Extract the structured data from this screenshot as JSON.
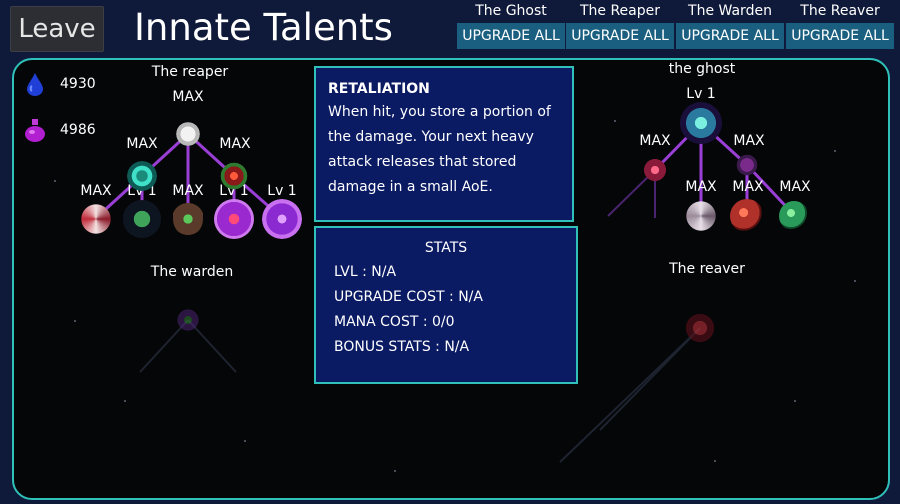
{
  "header": {
    "leave_label": "Leave",
    "title": "Innate Talents"
  },
  "upgrade_groups": [
    {
      "name": "The Ghost",
      "button": "UPGRADE ALL"
    },
    {
      "name": "The Reaper",
      "button": "UPGRADE ALL"
    },
    {
      "name": "The Warden",
      "button": "UPGRADE ALL"
    },
    {
      "name": "The Reaver",
      "button": "UPGRADE ALL"
    }
  ],
  "currencies": {
    "blue_mana": "4930",
    "purple_potion": "4986"
  },
  "trees": {
    "reaper": {
      "title": "The reaper",
      "labels": [
        "MAX",
        "MAX",
        "MAX",
        "MAX",
        "Lv 1",
        "MAX",
        "Lv 1",
        "Lv 1"
      ]
    },
    "ghost": {
      "title": "the ghost",
      "labels": [
        "Lv 1",
        "MAX",
        "MAX",
        "MAX",
        "MAX",
        "MAX"
      ]
    },
    "warden": {
      "title": "The warden"
    },
    "reaver": {
      "title": "The reaver"
    }
  },
  "info": {
    "name": "RETALIATION",
    "description": "When hit, you store a portion of the damage. Your next heavy attack releases that stored damage in a small AoE."
  },
  "stats": {
    "header": "STATS",
    "lines": [
      "LVL : N/A",
      "UPGRADE COST : N/A",
      "MANA COST : 0/0",
      "BONUS STATS : N/A"
    ]
  },
  "colors": {
    "accent": "#2fc1b9",
    "panel_bg": "#0a1a63",
    "button_bg": "#1b5f80",
    "line_purple": "#9a3fd6"
  }
}
